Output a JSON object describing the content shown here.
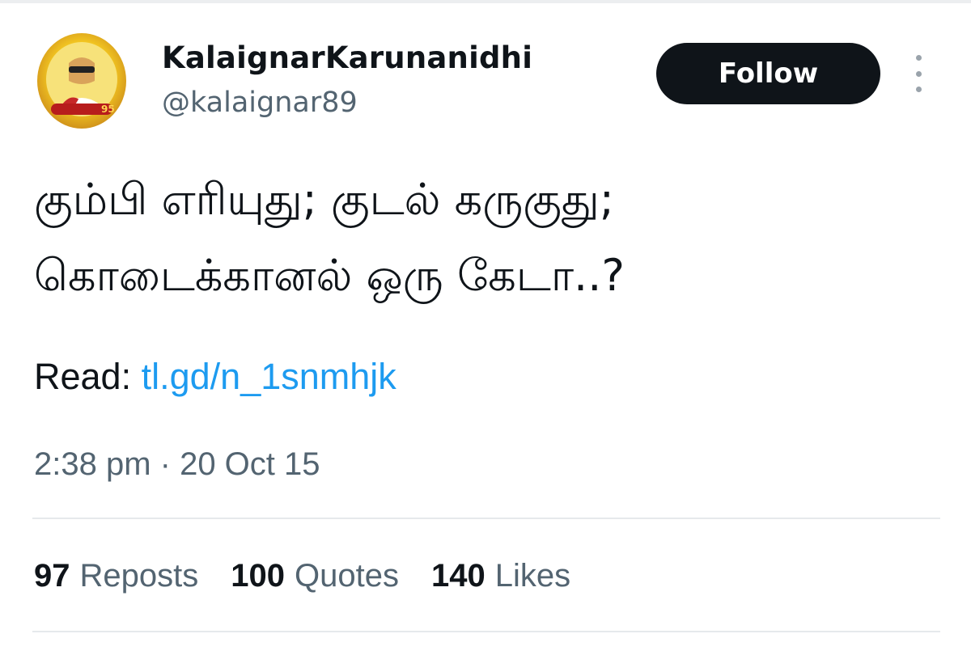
{
  "user": {
    "display_name": "KalaignarKarunanidhi",
    "handle": "@kalaignar89",
    "avatar_icon": "profile-avatar"
  },
  "follow_label": "Follow",
  "tweet": {
    "lines": [
      "கும்பி எரியுது; குடல் கருகுது;",
      "கொடைக்கானல் ஒரு கேடா..?"
    ],
    "read_label": "Read:",
    "link_text": "tl.gd/n_1snmhjk",
    "timestamp": "2:38 pm · 20 Oct 15"
  },
  "stats": [
    {
      "count": "97",
      "label": "Reposts"
    },
    {
      "count": "100",
      "label": "Quotes"
    },
    {
      "count": "140",
      "label": "Likes"
    }
  ],
  "colors": {
    "link": "#1d9bf0",
    "text": "#0f1419",
    "muted": "#536471",
    "button_bg": "#0f1419"
  }
}
